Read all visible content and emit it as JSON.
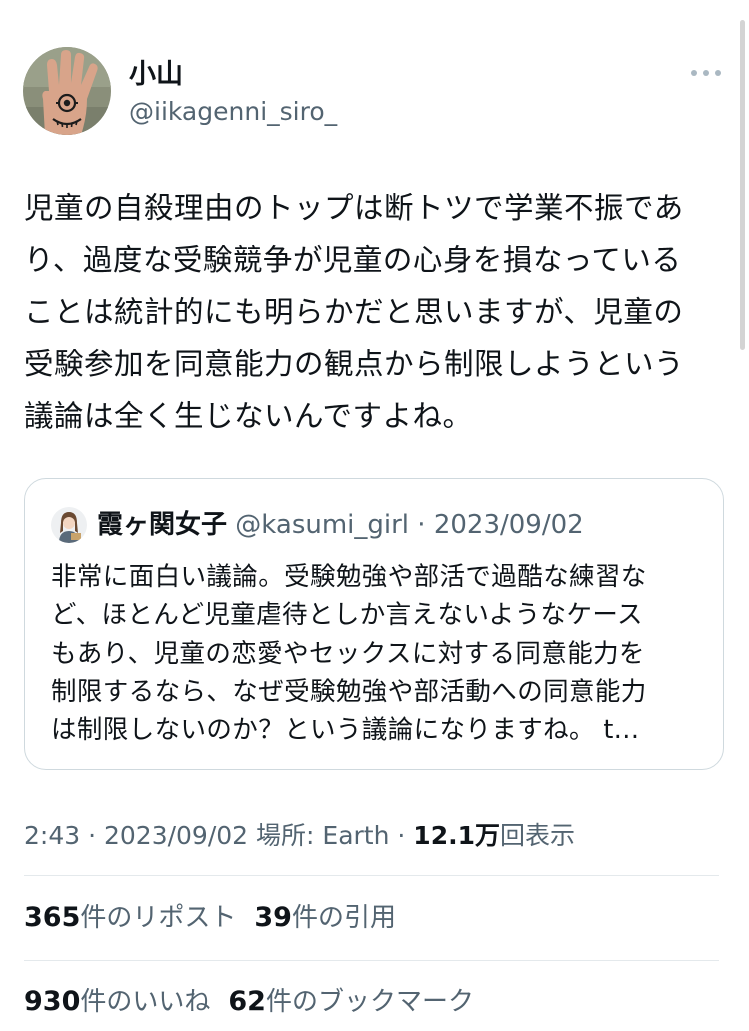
{
  "author": {
    "display_name": "小山",
    "handle": "@iikagenni_siro_",
    "avatar_icon": "hand-with-eye-avatar"
  },
  "more_icon": "more-dots-icon",
  "tweet": {
    "text": "児童の自殺理由のトップは断トツで学業不振であ\nり、過度な受験競争が児童の心身を損なっている\nことは統計的にも明らかだと思いますが、児童の\n受験参加を同意能力の観点から制限しようという\n議論は全く生じないんですよね。"
  },
  "quote": {
    "display_name": "霞ヶ関女子",
    "handle": "@kasumi_girl",
    "separator": " · ",
    "date": "2023/09/02",
    "text": "非常に面白い議論。受験勉強や部活で過酷な練習な\nど、ほとんど児童虐待としか言えないようなケース\nもあり、児童の恋愛やセックスに対する同意能力を\n制限するなら、なぜ受験勉強や部活動への同意能力\nは制限しないのか？という議論になりますね。 t..."
  },
  "meta": {
    "time_date": "2:43 · 2023/09/02 ",
    "location": "場所: Earth",
    "separator": " · ",
    "views_count": "12.1万",
    "views_label": "回表示"
  },
  "stats": {
    "reposts_count": "365",
    "reposts_label": "件のリポスト",
    "quotes_count": "39",
    "quotes_label": "件の引用",
    "likes_count": "930",
    "likes_label": "件のいいね",
    "bookmarks_count": "62",
    "bookmarks_label": "件のブックマーク"
  },
  "colors": {
    "text_primary": "#0f1419",
    "text_secondary": "#536471",
    "border": "#cfd9de",
    "background": "#ffffff"
  }
}
